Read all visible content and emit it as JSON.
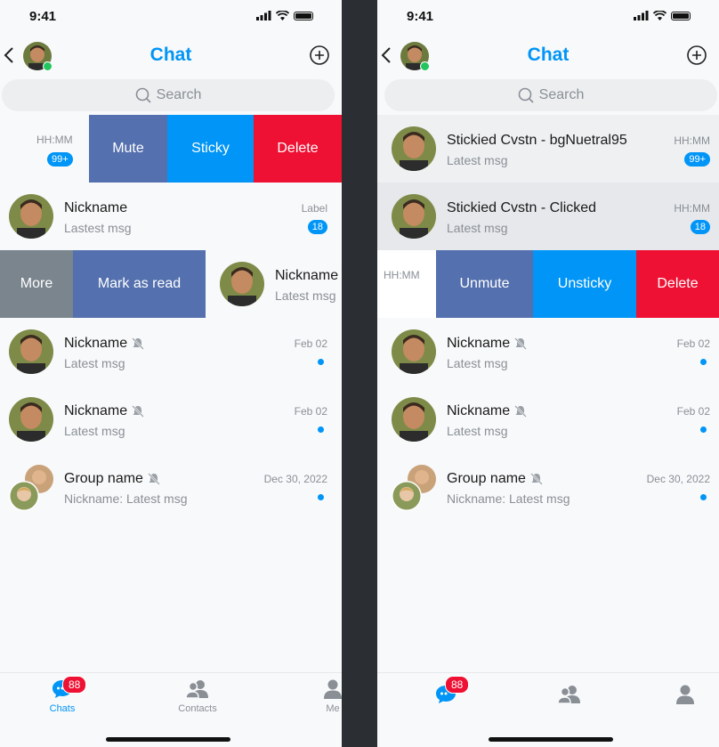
{
  "status": {
    "time": "9:41"
  },
  "header": {
    "title": "Chat"
  },
  "search": {
    "placeholder": "Search"
  },
  "left": {
    "row1": {
      "date": "HH:MM",
      "badge": "99+",
      "actions": [
        "Mute",
        "Sticky",
        "Delete"
      ]
    },
    "row2": {
      "name": "Nickname",
      "msg": "Lastest msg",
      "date": "Label",
      "badge": "18"
    },
    "row3": {
      "name": "Nickname",
      "msg": "Latest msg",
      "actions": [
        "More",
        "Mark as read"
      ]
    },
    "row4": {
      "name": "Nickname",
      "msg": "Latest msg",
      "date": "Feb 02"
    },
    "row5": {
      "name": "Nickname",
      "msg": "Latest msg",
      "date": "Feb 02"
    },
    "row6": {
      "name": "Group name",
      "msg": "Nickname: Latest msg",
      "date": "Dec 30, 2022"
    }
  },
  "right": {
    "row1": {
      "name": "Stickied Cvstn - bgNuetral95",
      "msg": "Latest msg",
      "date": "HH:MM",
      "badge": "99+"
    },
    "row2": {
      "name": "Stickied Cvstn - Clicked",
      "msg": "Latest msg",
      "date": "HH:MM",
      "badge": "18"
    },
    "row3": {
      "date": "HH:MM",
      "actions": [
        "Unmute",
        "Unsticky",
        "Delete"
      ]
    },
    "row4": {
      "name": "Nickname",
      "msg": "Latest msg",
      "date": "Feb 02"
    },
    "row5": {
      "name": "Nickname",
      "msg": "Latest msg",
      "date": "Feb 02"
    },
    "row6": {
      "name": "Group name",
      "msg": "Nickname: Latest msg",
      "date": "Dec 30, 2022"
    }
  },
  "tabbar": {
    "chats": "Chats",
    "chats_badge": "88",
    "contacts": "Contacts",
    "me": "Me"
  },
  "colors": {
    "accent": "#0095f6",
    "mute": "#5470ae",
    "sticky": "#0095f6",
    "delete": "#ee1133",
    "more": "#7a858e",
    "badge_red": "#ee1133"
  },
  "icons": [
    "back-icon",
    "plus-icon",
    "search-icon",
    "bell-off-icon",
    "chat-bubble-icon",
    "contacts-icon",
    "person-icon"
  ]
}
